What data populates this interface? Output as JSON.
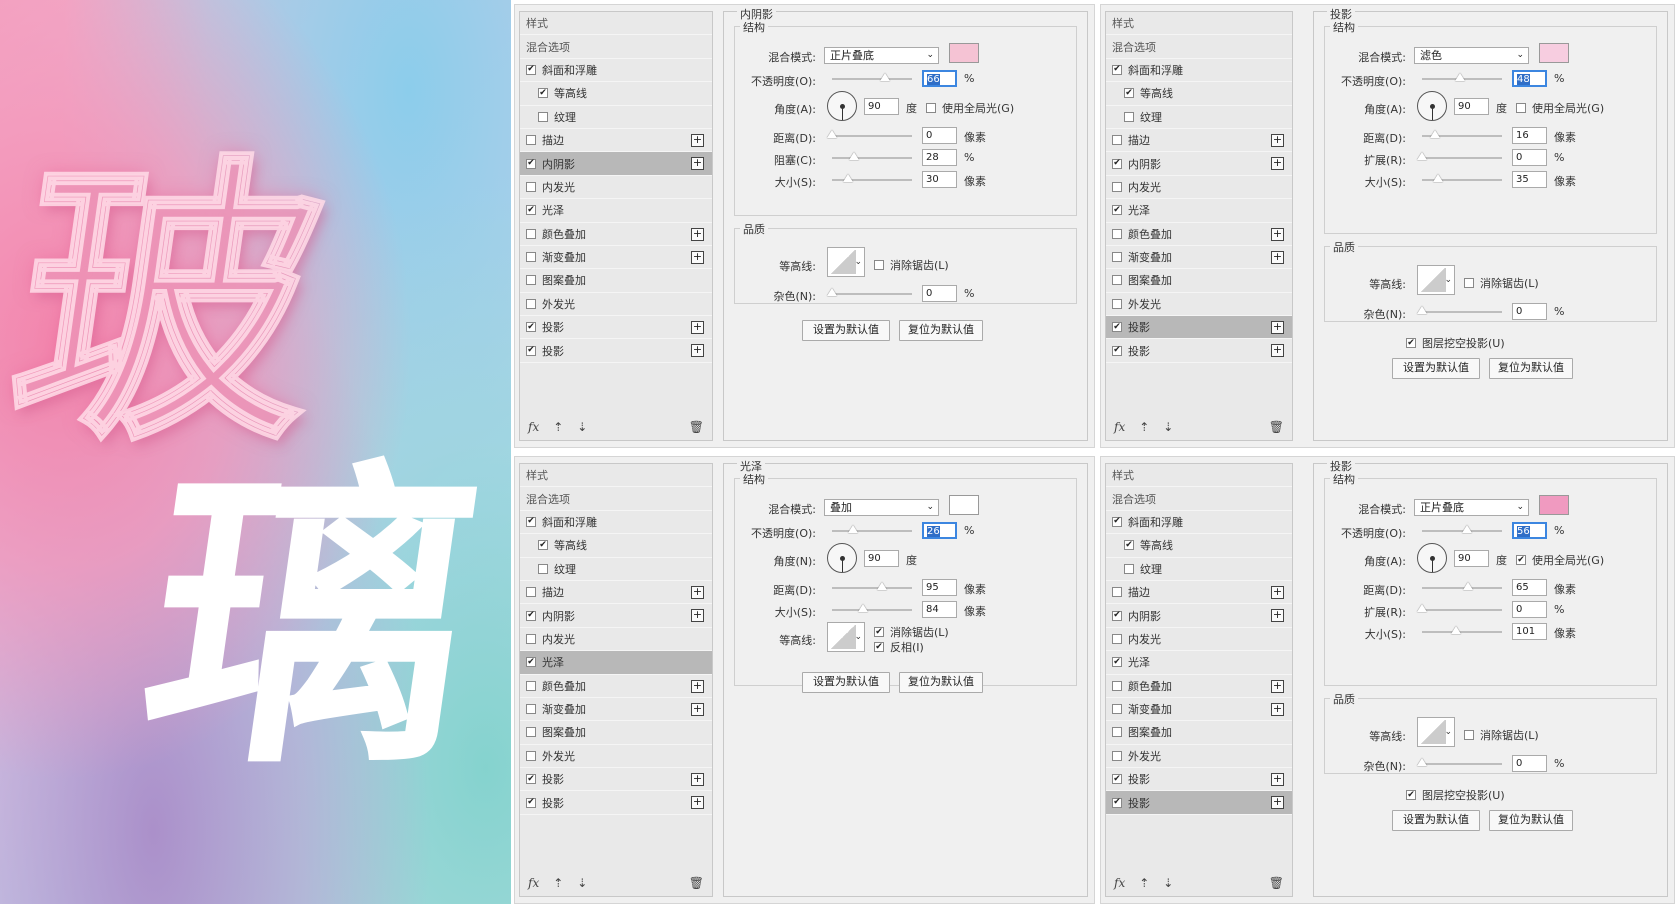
{
  "art": {
    "char1": "玻",
    "char2": "璃"
  },
  "sidebar_common": {
    "styles_label": "样式",
    "blend_options_label": "混合选项",
    "items": [
      "斜面和浮雕",
      "等高线",
      "纹理",
      "描边",
      "内阴影",
      "内发光",
      "光泽",
      "颜色叠加",
      "渐变叠加",
      "图案叠加",
      "外发光",
      "投影",
      "投影"
    ],
    "footer_icons": [
      "fx-icon",
      "arrow-up-icon",
      "arrow-down-icon",
      "trash-icon"
    ]
  },
  "panels": [
    {
      "title": "内阴影",
      "checked": [
        true,
        true,
        false,
        false,
        true,
        false,
        true,
        false,
        false,
        false,
        false,
        true,
        true
      ],
      "selected": 4,
      "section_structure": "结构",
      "section_quality": "品质",
      "blend_label": "混合模式:",
      "blend_value": "正片叠底",
      "swatch": "#f5c3d4",
      "opacity_label": "不透明度(O):",
      "opacity": "66",
      "opacity_pos": 0.66,
      "angle_label": "角度(A):",
      "angle": "90",
      "degree": "度",
      "global_light": "使用全局光(G)",
      "global_checked": false,
      "r1_label": "距离(D):",
      "r1": "0",
      "r1_unit": "像素",
      "r1_pos": 0,
      "r2_label": "阻塞(C):",
      "r2": "28",
      "r2_unit": "%",
      "r2_pos": 0.28,
      "r3_label": "大小(S):",
      "r3": "30",
      "r3_unit": "像素",
      "r3_pos": 0.2,
      "contour_label": "等高线:",
      "antialias": "消除锯齿(L)",
      "antialias_checked": false,
      "noise_label": "杂色(N):",
      "noise": "0",
      "noise_pos": 0,
      "set_default": "设置为默认值",
      "reset_default": "复位为默认值"
    },
    {
      "title": "投影",
      "checked": [
        true,
        true,
        false,
        false,
        true,
        false,
        true,
        false,
        false,
        false,
        false,
        true,
        true
      ],
      "selected": 11,
      "section_structure": "结构",
      "section_quality": "品质",
      "blend_label": "混合模式:",
      "blend_value": "滤色",
      "swatch": "#f7cde0",
      "opacity_label": "不透明度(O):",
      "opacity": "48",
      "opacity_pos": 0.48,
      "angle_label": "角度(A):",
      "angle": "90",
      "degree": "度",
      "global_light": "使用全局光(G)",
      "global_checked": false,
      "r1_label": "距离(D):",
      "r1": "16",
      "r1_unit": "像素",
      "r1_pos": 0.16,
      "r2_label": "扩展(R):",
      "r2": "0",
      "r2_unit": "%",
      "r2_pos": 0,
      "r3_label": "大小(S):",
      "r3": "35",
      "r3_unit": "像素",
      "r3_pos": 0.2,
      "contour_label": "等高线:",
      "antialias": "消除锯齿(L)",
      "antialias_checked": false,
      "noise_label": "杂色(N):",
      "noise": "0",
      "noise_pos": 0,
      "knockout": "图层挖空投影(U)",
      "knockout_checked": true,
      "set_default": "设置为默认值",
      "reset_default": "复位为默认值"
    },
    {
      "title": "光泽",
      "checked": [
        true,
        true,
        false,
        false,
        true,
        false,
        true,
        false,
        false,
        false,
        false,
        true,
        true
      ],
      "selected": 6,
      "section_structure": "结构",
      "blend_label": "混合模式:",
      "blend_value": "叠加",
      "swatch": "#ffffff",
      "opacity_label": "不透明度(O):",
      "opacity": "26",
      "opacity_pos": 0.26,
      "angle_label": "角度(N):",
      "angle": "90",
      "degree": "度",
      "r1_label": "距离(D):",
      "r1": "95",
      "r1_unit": "像素",
      "r1_pos": 0.62,
      "r2_label": "大小(S):",
      "r2": "84",
      "r2_unit": "像素",
      "r2_pos": 0.39,
      "contour_label": "等高线:",
      "antialias": "消除锯齿(L)",
      "antialias_checked": true,
      "invert": "反相(I)",
      "invert_checked": true,
      "set_default": "设置为默认值",
      "reset_default": "复位为默认值"
    },
    {
      "title": "投影",
      "checked": [
        true,
        true,
        false,
        false,
        true,
        false,
        true,
        false,
        false,
        false,
        false,
        true,
        true
      ],
      "selected": 12,
      "section_structure": "结构",
      "section_quality": "品质",
      "blend_label": "混合模式:",
      "blend_value": "正片叠底",
      "swatch": "#f09ac0",
      "opacity_label": "不透明度(O):",
      "opacity": "56",
      "opacity_pos": 0.56,
      "angle_label": "角度(A):",
      "angle": "90",
      "degree": "度",
      "global_light": "使用全局光(G)",
      "global_checked": true,
      "r1_label": "距离(D):",
      "r1": "65",
      "r1_unit": "像素",
      "r1_pos": 0.58,
      "r2_label": "扩展(R):",
      "r2": "0",
      "r2_unit": "%",
      "r2_pos": 0,
      "r3_label": "大小(S):",
      "r3": "101",
      "r3_unit": "像素",
      "r3_pos": 0.42,
      "contour_label": "等高线:",
      "antialias": "消除锯齿(L)",
      "antialias_checked": false,
      "noise_label": "杂色(N):",
      "noise": "0",
      "noise_pos": 0,
      "knockout": "图层挖空投影(U)",
      "knockout_checked": true,
      "set_default": "设置为默认值",
      "reset_default": "复位为默认值"
    }
  ]
}
